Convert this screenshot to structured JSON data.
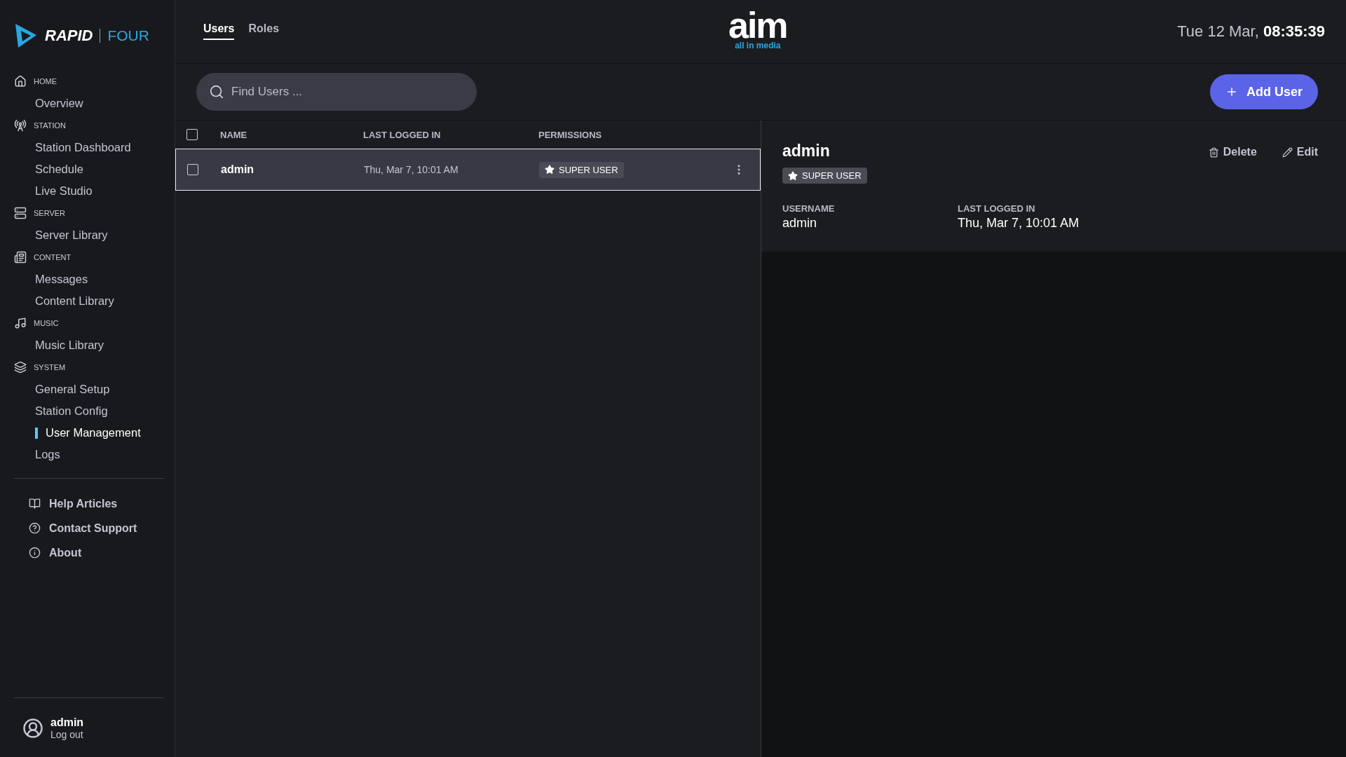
{
  "sidebar": {
    "brand": {
      "name": "RAPID",
      "suffix": "FOUR"
    },
    "sections": [
      {
        "label": "HOME",
        "items": [
          {
            "label": "Overview",
            "selected": false
          }
        ]
      },
      {
        "label": "STATION",
        "items": [
          {
            "label": "Station Dashboard",
            "selected": false
          },
          {
            "label": "Schedule",
            "selected": false
          },
          {
            "label": "Live Studio",
            "selected": false
          }
        ]
      },
      {
        "label": "SERVER",
        "items": [
          {
            "label": "Server Library",
            "selected": false
          }
        ]
      },
      {
        "label": "CONTENT",
        "items": [
          {
            "label": "Messages",
            "selected": false
          },
          {
            "label": "Content Library",
            "selected": false
          }
        ]
      },
      {
        "label": "MUSIC",
        "items": [
          {
            "label": "Music Library",
            "selected": false
          }
        ]
      },
      {
        "label": "SYSTEM",
        "items": [
          {
            "label": "General Setup",
            "selected": false
          },
          {
            "label": "Station Config",
            "selected": false
          },
          {
            "label": "User Management",
            "selected": true
          },
          {
            "label": "Logs",
            "selected": false
          }
        ]
      }
    ],
    "links": [
      {
        "label": "Help Articles"
      },
      {
        "label": "Contact Support"
      },
      {
        "label": "About"
      }
    ],
    "user": {
      "name": "admin",
      "action": "Log out"
    }
  },
  "header": {
    "tabs": [
      {
        "label": "Users",
        "selected": true
      },
      {
        "label": "Roles",
        "selected": false
      }
    ],
    "logo": {
      "word": "aim",
      "tagline": "all in media"
    },
    "datetime": "Tue 12 Mar, **08:35:39**"
  },
  "toolbar": {
    "search": {
      "placeholder": "Find Users ..."
    },
    "add_button": "Add User"
  },
  "table": {
    "select_all": {
      "checked": false
    },
    "columns": [
      "NAME",
      "LAST LOGGED IN",
      "PERMISSIONS"
    ],
    "rows": [
      {
        "name": "admin",
        "last_logged_in": "Thu, Mar 7, 10:01 AM",
        "permission": "SUPER USER",
        "selected": true,
        "checked": false
      }
    ]
  },
  "detail": {
    "title": "admin",
    "badge": "SUPER USER",
    "actions": [
      {
        "label": "Delete"
      },
      {
        "label": "Edit"
      }
    ],
    "fields": [
      {
        "label": "USERNAME",
        "value": "admin"
      },
      {
        "label": "LAST LOGGED IN",
        "value": "Thu, Mar 7, 10:01 AM"
      }
    ]
  }
}
